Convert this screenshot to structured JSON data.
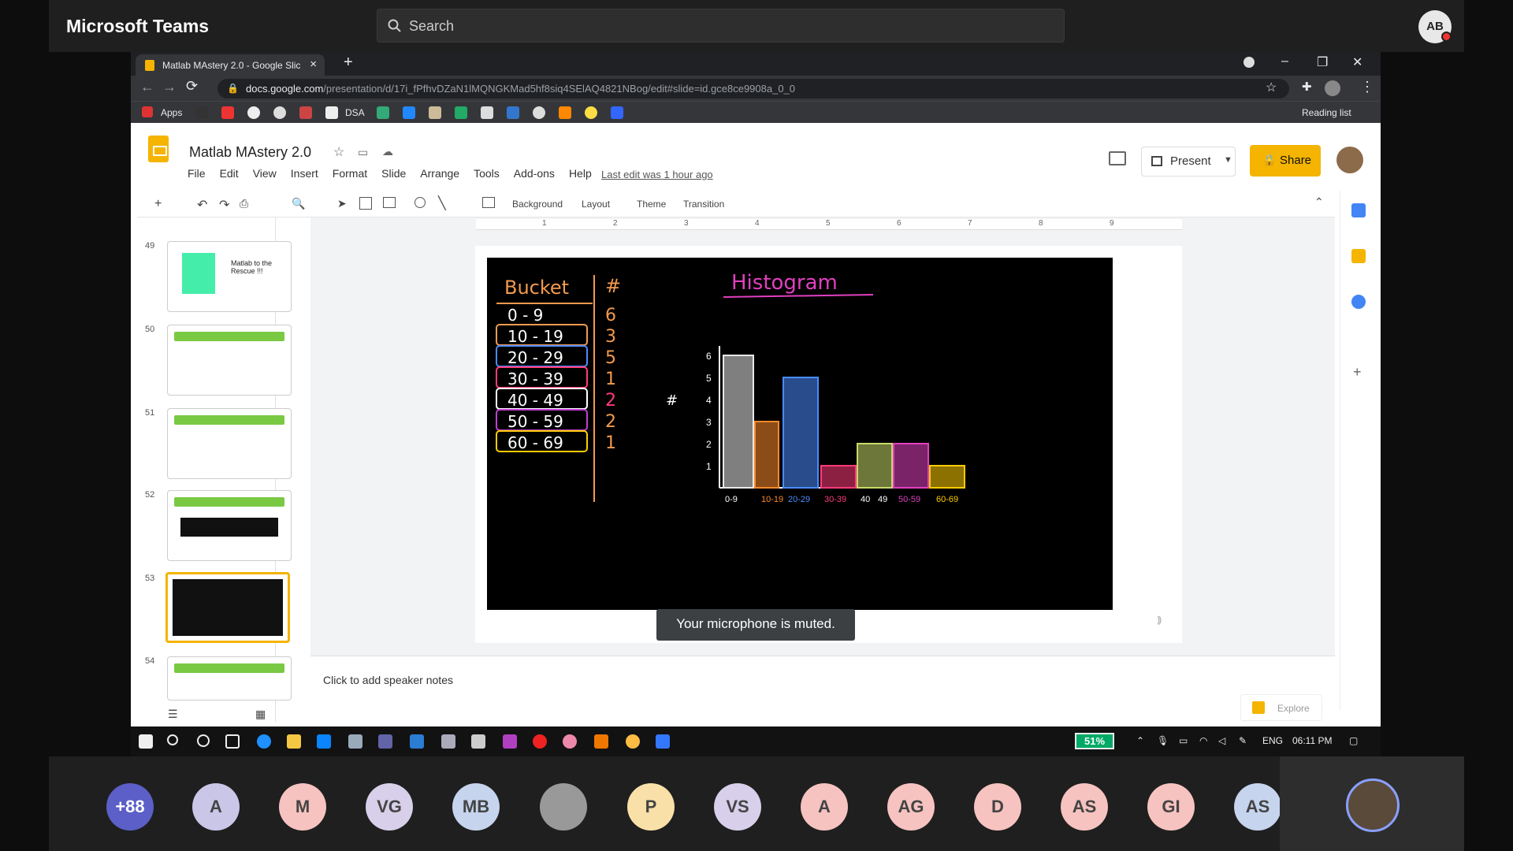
{
  "teams": {
    "title": "Microsoft Teams",
    "search_placeholder": "Search",
    "me_initials": "AB"
  },
  "browser": {
    "tab_title": "Matlab MAstery 2.0 - Google Slic",
    "url_domain": "docs.google.com",
    "url_path": "/presentation/d/17i_fPfhvDZaN1lMQNGKMad5hf8siq4SElAQ4821NBog/edit#slide=id.gce8ce9908a_0_0",
    "bookmarks": [
      "Apps",
      "DSA"
    ],
    "reading_list": "Reading list"
  },
  "slides": {
    "doc_title": "Matlab MAstery 2.0",
    "menu": [
      "File",
      "Edit",
      "View",
      "Insert",
      "Format",
      "Slide",
      "Arrange",
      "Tools",
      "Add-ons",
      "Help"
    ],
    "last_edit": "Last edit was 1 hour ago",
    "present_label": "Present",
    "share_label": "Share",
    "toolbar": {
      "background": "Background",
      "layout": "Layout",
      "theme": "Theme",
      "transition": "Transition"
    },
    "ruler_ticks": [
      "1",
      "2",
      "3",
      "4",
      "5",
      "6",
      "7",
      "8",
      "9"
    ],
    "filmstrip": [
      {
        "num": "49",
        "text": "Matlab to the Rescue !!!"
      },
      {
        "num": "50"
      },
      {
        "num": "51"
      },
      {
        "num": "52"
      },
      {
        "num": "53"
      },
      {
        "num": "54"
      }
    ],
    "notes_placeholder": "Click to add speaker notes",
    "explore_label": "Explore",
    "toast": "Your microphone is muted."
  },
  "slide_content": {
    "table_header_bucket": "Bucket",
    "table_header_count": "#",
    "rows": [
      {
        "bucket": "0 - 9",
        "count": "6"
      },
      {
        "bucket": "10 - 19",
        "count": "3"
      },
      {
        "bucket": "20 - 29",
        "count": "5"
      },
      {
        "bucket": "30 - 39",
        "count": "1"
      },
      {
        "bucket": "40 - 49",
        "count": "2"
      },
      {
        "bucket": "50 - 59",
        "count": "2"
      },
      {
        "bucket": "60 - 69",
        "count": "1"
      }
    ],
    "chart_title": "Histogram",
    "y_axis_label": "#",
    "y_ticks": [
      "1",
      "2",
      "3",
      "4",
      "5",
      "6"
    ],
    "x_ticks": [
      "0-9",
      "10-19",
      "20-29",
      "30-39",
      "40",
      "49",
      "50-59",
      "60-69"
    ],
    "colors": {
      "bar_0_9": "#e8e8e8",
      "bar_10_19": "#ff8a2a",
      "bar_20_29": "#4a8cff",
      "bar_30_39": "#ff3b7a",
      "bar_40_49": "#c8d86a",
      "bar_50_59": "#e040c0",
      "bar_60_69": "#ffcc00"
    }
  },
  "chart_data": {
    "type": "bar",
    "title": "Histogram",
    "categories": [
      "0-9",
      "10-19",
      "20-29",
      "30-39",
      "40-49",
      "50-59",
      "60-69"
    ],
    "values": [
      6,
      3,
      5,
      1,
      2,
      2,
      1
    ],
    "ylabel": "#",
    "xlabel": "",
    "ylim": [
      0,
      6
    ]
  },
  "taskbar": {
    "battery": "51%",
    "lang": "ENG",
    "time": "06:11 PM"
  },
  "participants": [
    "+88",
    "A",
    "M",
    "VG",
    "MB",
    "",
    "P",
    "VS",
    "A",
    "AG",
    "D",
    "AS",
    "GI",
    "AS"
  ],
  "participant_colors": [
    "#5b5fc7",
    "#c9c6e8",
    "#f6c3c0",
    "#d8d0ea",
    "#c6d4ee",
    "#999",
    "#f8e0a8",
    "#d8d0ea",
    "#f6c3c0",
    "#f6c3c0",
    "#f6c3c0",
    "#f6c3c0",
    "#f6c3c0",
    "#c6d4ee"
  ]
}
